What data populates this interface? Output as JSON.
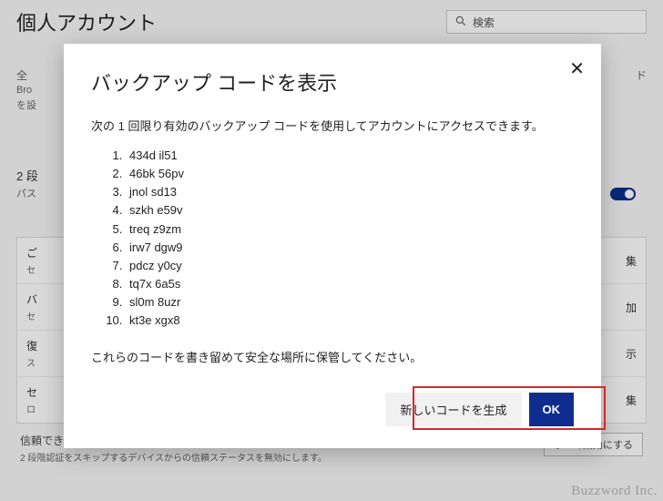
{
  "bg": {
    "page_title": "個人アカウント",
    "search_placeholder": "検索",
    "fragment_all": "全",
    "fragment_right": "ド",
    "bi_line": "Bro",
    "bi_sub": "を設",
    "two_step_label": "2 段",
    "two_step_sub": "パス",
    "rows": [
      {
        "label": "ご",
        "desc": "セ",
        "action": "集"
      },
      {
        "label": "バ",
        "desc": "セ",
        "action": "加"
      },
      {
        "label": "復",
        "desc": "ス",
        "action": "示"
      },
      {
        "label": "セ",
        "desc": "ロ",
        "action": "集"
      }
    ],
    "trusted_label": "信頼できるデバイス",
    "trusted_desc": "2 段階認証をスキップするデバイスからの信頼ステータスを無効にします。",
    "trusted_action": "すべて無効にする"
  },
  "modal": {
    "title": "バックアップ コードを表示",
    "description": "次の 1 回限り有効のバックアップ コードを使用してアカウントにアクセスできます。",
    "codes": [
      "434d il51",
      "46bk 56pv",
      "jnol sd13",
      "szkh e59v",
      "treq z9zm",
      "irw7 dgw9",
      "pdcz y0cy",
      "tq7x 6a5s",
      "sl0m 8uzr",
      "kt3e xgx8"
    ],
    "note": "これらのコードを書き留めて安全な場所に保管してください。",
    "generate_label": "新しいコードを生成",
    "ok_label": "OK"
  },
  "watermark": "Buzzword Inc."
}
